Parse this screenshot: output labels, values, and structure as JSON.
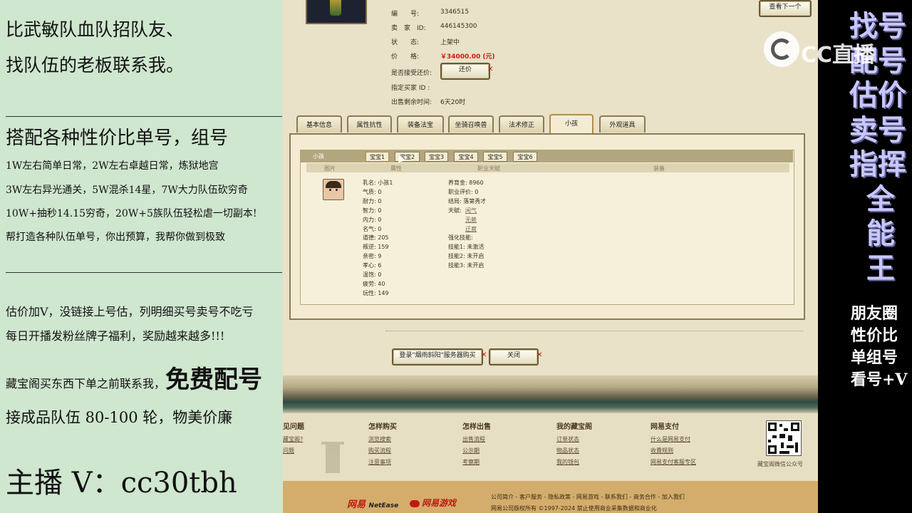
{
  "left": {
    "line1": "比武敏队血队招队友、",
    "line2": "找队伍的老板联系我。",
    "heading": "搭配各种性价比单号，组号",
    "bullets": [
      "1W左右简单日常，2W左右卓越日常，炼狱地宫",
      "3W左右异光通关，5W混杀14星，7W大力队伍砍穷奇",
      "10W+抽秒14.15穷奇，20W+5族队伍轻松虐一切副本!",
      "帮打造各种队伍单号，你出预算，我帮你做到极致"
    ],
    "notes": [
      "估价加V，没链接上号估，列明细买号卖号不吃亏",
      "每日开播发粉丝牌子福利，奖励越来越多!!!"
    ],
    "note3_prefix": "藏宝阁买东西下单之前联系我，",
    "note3_big": "免费配号",
    "note4": "接成品队伍 80-100 轮，物美价廉",
    "contact": "主播 V：cc30tbh"
  },
  "listing": {
    "fields": [
      {
        "label": "编　　号:",
        "value": "3346515"
      },
      {
        "label": "卖　家　ID:",
        "value": "446145300"
      },
      {
        "label": "状　　态:",
        "value": "上架中"
      },
      {
        "label": "价　　格:",
        "value": "￥34000.00 (元)"
      },
      {
        "label": "是否接受还价:",
        "value": ""
      },
      {
        "label": "指定买家 ID :",
        "value": ""
      },
      {
        "label": "出售剩余时间:",
        "value": "6天20时"
      }
    ],
    "bargain_button": "还价",
    "next_button": "查看下一个"
  },
  "tabs": [
    "基本信息",
    "属性抗性",
    "装备法宝",
    "坐骑召唤兽",
    "法术修正",
    "小孩",
    "外观道具"
  ],
  "active_tab": "小孩",
  "child_panel": {
    "title": "小孩",
    "subtabs": [
      "宝宝1",
      "宝宝2",
      "宝宝3",
      "宝宝4",
      "宝宝5",
      "宝宝6"
    ],
    "col_headers": [
      "图片",
      "属性",
      "职业天赋",
      "装备"
    ],
    "col1": [
      {
        "k": "乳名",
        "v": "小孩1"
      },
      {
        "k": "气质",
        "v": "0"
      },
      {
        "k": "耐力",
        "v": "0"
      },
      {
        "k": "智力",
        "v": "0"
      },
      {
        "k": "内力",
        "v": "0"
      },
      {
        "k": "名气",
        "v": "0"
      },
      {
        "k": "道德",
        "v": "205"
      },
      {
        "k": "叛逆",
        "v": "159"
      },
      {
        "k": "亲密",
        "v": "9"
      },
      {
        "k": "孝心",
        "v": "6"
      },
      {
        "k": "温饱",
        "v": "0"
      },
      {
        "k": "疲劳",
        "v": "40"
      },
      {
        "k": "玩性",
        "v": "149"
      }
    ],
    "col2": {
      "raise_k": "养育金",
      "raise_v": "8960",
      "eval_k": "职业评价",
      "eval_v": "0",
      "ending_k": "结局",
      "ending_v": "落第秀才",
      "talent_k": "天赋",
      "talents": [
        "闲气",
        "无赖",
        "迂腐"
      ],
      "strengthen": "强化技能:",
      "skills": [
        {
          "k": "技能1",
          "v": "未激活"
        },
        {
          "k": "技能2",
          "v": "未开启"
        },
        {
          "k": "技能3",
          "v": "未开启"
        }
      ]
    }
  },
  "bottom_buttons": {
    "login": "登录\"烟雨斜阳\"服务器购买",
    "close": "关闭"
  },
  "footer": {
    "columns": [
      {
        "head": "见问题",
        "links": [
          "藏宝阁?",
          "问题"
        ]
      },
      {
        "head": "怎样购买",
        "links": [
          "浏览搜索",
          "购买流程",
          "注意事项"
        ]
      },
      {
        "head": "怎样出售",
        "links": [
          "出售流程",
          "公示期",
          "考察期"
        ]
      },
      {
        "head": "我的藏宝阁",
        "links": [
          "订单状态",
          "物品状态",
          "我的钱包"
        ]
      },
      {
        "head": "网易支付",
        "links": [
          "什么是网易支付",
          "收費规则",
          "网易支付客服专区"
        ]
      }
    ],
    "qr_caption": "藏宝阁微信公众号",
    "brand_netease": "NetEase",
    "brand_netease_cn": "网易",
    "brand_games": "网易游戏",
    "links_line": "公司简介 - 客户服务 - 隐私政策 - 网易游戏 - 联系我们 - 商务合作 - 加入我们",
    "copyright": "网易公司版权所有 ©1997-2024  禁止使用商业采集数据和商业化"
  },
  "right": {
    "big_lines": [
      "找号",
      "配号",
      "估价",
      "卖号",
      "指挥",
      "全",
      "能",
      "王"
    ],
    "small_lines": [
      "朋友圈",
      "性价比",
      "单组号",
      "看号+V"
    ],
    "watermark": "CC直播"
  },
  "colors": {
    "left_bg": "#cfe6cf",
    "center_bg": "#e9e1c8",
    "right_bg": "#000000",
    "price_red": "#d01a10",
    "purple_text": "#c7c7ff"
  }
}
